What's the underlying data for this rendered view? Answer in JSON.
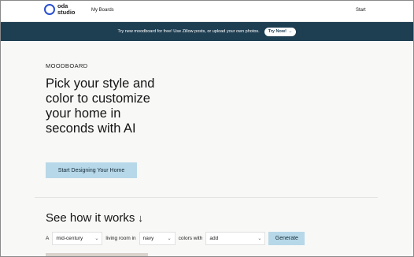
{
  "header": {
    "logo_line1": "oda",
    "logo_line2": "studio",
    "nav_my_boards": "My Boards",
    "start": "Start"
  },
  "banner": {
    "text": "Try new moodboard for free! Use Zillow posts, or upload your own photos.",
    "button_label": "Try Now!",
    "button_icon": "arrow-right-icon"
  },
  "hero": {
    "eyebrow": "MOODBOARD",
    "headline": "Pick your style and color to customize your home in seconds with AI",
    "cta_label": "Start Designing Your Home"
  },
  "how_it_works": {
    "title": "See how it works",
    "icon": "arrow-down-icon"
  },
  "configurator": {
    "word_a": "A",
    "style_value": "mid-century",
    "word_room": "living room in",
    "color_value": "navy",
    "word_with": "colors with",
    "add_value": "add",
    "generate_label": "Generate"
  },
  "colors": {
    "banner_bg": "#1e3e52",
    "accent_button": "#b7d8e8",
    "logo_blue": "#2a4fd0",
    "hero_bg": "#f8f8f7"
  }
}
